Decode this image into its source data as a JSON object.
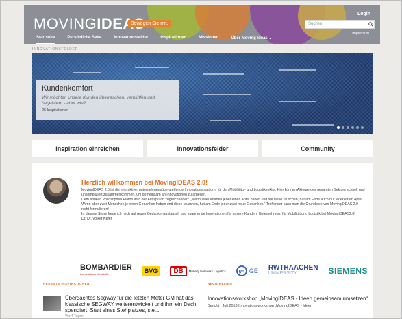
{
  "header": {
    "logo_light": "MOVING",
    "logo_bold": "IDEAS",
    "tagline": "Bewegen Sie mit.",
    "login": "Login",
    "search_placeholder": "Suchen",
    "impressum": "Impressum",
    "colors": {
      "bg": "#8c8f95",
      "accent": "#e3832e"
    }
  },
  "nav": {
    "items": [
      "Startseite",
      "Persönliche Seite",
      "Innovationsfelder",
      "Inspirationen",
      "Missionen",
      "Über Moving Ideas ⌄"
    ],
    "active_index": 0
  },
  "breadcrumb": "INNOVATIONSFELDER",
  "hero": {
    "title": "Kundenkomfort",
    "text": "Wir möchten unsere Kunden überraschen, verblüffen und begeistern - aber wie?",
    "count": "26 Inspirationen",
    "slides": 6,
    "active_slide": 0
  },
  "buttons": [
    "Inspiration einreichen",
    "Innovationsfelder",
    "Community"
  ],
  "welcome": {
    "heading": "Herzlich willkommen bei MovingIDEAS 2.0!",
    "paragraphs": [
      "MovingIDEAS 2.0 ist die interaktive, unternehmensübergreifende Innovationsplattform für den Mobilitäts- und Logistiksektor. Hier können Akteure des gesamten Sektors schnell und unkompliziert zusammenkommen, um gemeinsam an Innovationen zu arbeiten.",
      "Dem antiken Philosophen Platon wird der Ausspruch zugeschrieben: „Wenn zwei Knaben jeder einen Apfel haben und sie diese tauschen, hat am Ende auch nur jeder einen Apfel. Wenn aber zwei Menschen je einen Gedanken haben und diese tauschen, hat am Ende jeder zwei neue Gedanken.“ Treffender kann man die Grundidee von MovingIDEAS 2.0 nicht formulieren!",
      "In diesem Sinne freue ich mich auf regen Gedankenaustausch und spannende Innovationen für unsere Kunden, Unternehmen, für Mobilität und Logistik bei MovingIDEAS2.0!"
    ],
    "signature": "Dr. Dr. Volker Kefer"
  },
  "partners": {
    "bombardier": "BOMBARDIER",
    "bombardier_sub": "the evolution of mobility",
    "bvg": "BVG",
    "db": "DB",
    "db_sub": "Mobility Networks Logistics",
    "ge": "GE",
    "rwth": "RWTHAACHEN",
    "rwth_sub": "UNIVERSITY",
    "siemens": "SIEMENS"
  },
  "sections": {
    "latest_inspirations": "NEUESTE INSPIRATIONEN",
    "news": "NEUIGKEITEN"
  },
  "inspiration": {
    "title": "Überdachtes Segway für die letzten Meter GM hat das klassische SEGWAY weiterentwickelt und ihm ein Dach spendiert. Statt eines Stehplatzes, ste...",
    "more": "Vor 4 Tagen"
  },
  "news": {
    "title": "Innovationsworkshop „MovingIDEAS - Ideen gemeinsam umsetzen“",
    "text": "Bericht | Juli 2013 Innovationsworkshop „MovingIDEAS - Ideen"
  }
}
